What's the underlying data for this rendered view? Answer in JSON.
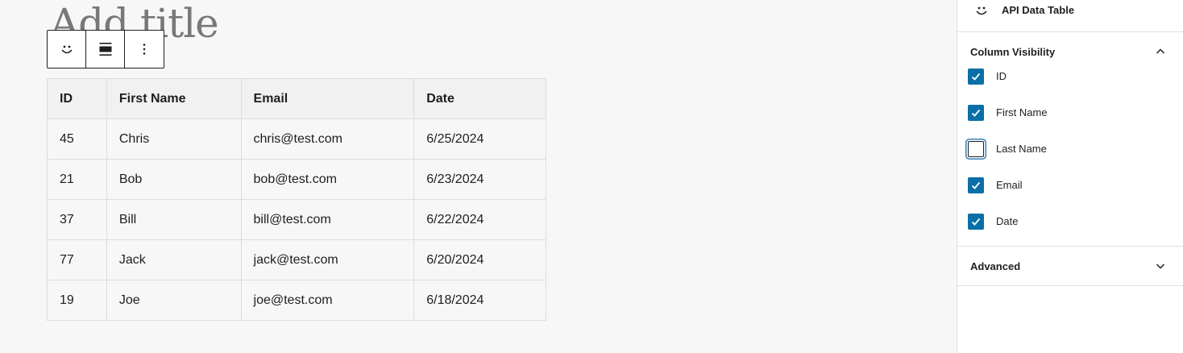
{
  "editor": {
    "title_placeholder": "Add title"
  },
  "block_toolbar": {
    "buttons": [
      {
        "icon": "smiley-block-icon"
      },
      {
        "icon": "align-icon"
      },
      {
        "icon": "more-options-icon"
      }
    ]
  },
  "table": {
    "headers": [
      "ID",
      "First Name",
      "Email",
      "Date"
    ],
    "rows": [
      [
        "45",
        "Chris",
        "chris@test.com",
        "6/25/2024"
      ],
      [
        "21",
        "Bob",
        "bob@test.com",
        "6/23/2024"
      ],
      [
        "37",
        "Bill",
        "bill@test.com",
        "6/22/2024"
      ],
      [
        "77",
        "Jack",
        "jack@test.com",
        "6/20/2024"
      ],
      [
        "19",
        "Joe",
        "joe@test.com",
        "6/18/2024"
      ]
    ]
  },
  "sidebar": {
    "block_name": "API Data Table",
    "column_visibility": {
      "title": "Column Visibility",
      "expanded": true,
      "options": [
        {
          "label": "ID",
          "checked": true
        },
        {
          "label": "First Name",
          "checked": true
        },
        {
          "label": "Last Name",
          "checked": false
        },
        {
          "label": "Email",
          "checked": true
        },
        {
          "label": "Date",
          "checked": true
        }
      ]
    },
    "advanced": {
      "title": "Advanced",
      "expanded": false
    }
  },
  "colors": {
    "accent": "#0a6fa8",
    "focus_ring": "#3a81b5",
    "canvas_bg": "#f7f7f7"
  }
}
